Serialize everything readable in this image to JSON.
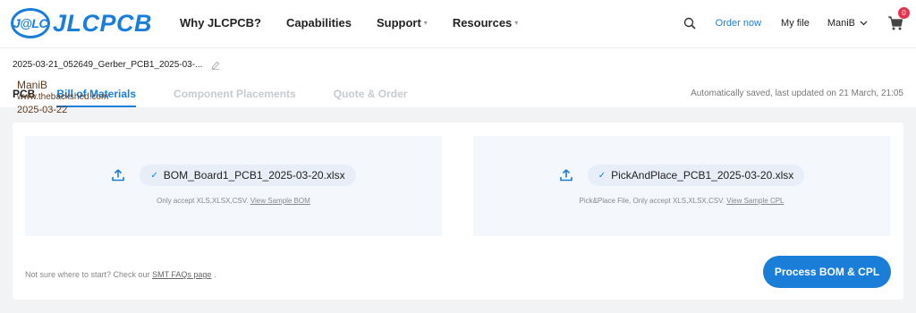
{
  "header": {
    "logo_mark": "J@LC",
    "logo_text": "JLCPCB",
    "nav": [
      {
        "label": "Why JLCPCB?",
        "dropdown": false
      },
      {
        "label": "Capabilities",
        "dropdown": false
      },
      {
        "label": "Support",
        "dropdown": true
      },
      {
        "label": "Resources",
        "dropdown": true
      }
    ],
    "order_now": "Order now",
    "my_file": "My file",
    "user": "ManiB",
    "cart_count": "0"
  },
  "file": {
    "name": "2025-03-21_052649_Gerber_PCB1_2025-03-..."
  },
  "tabs": [
    {
      "label": "PCB",
      "state": "done"
    },
    {
      "label": "Bill of Materials",
      "state": "active"
    },
    {
      "label": "Component Placements",
      "state": "pending"
    },
    {
      "label": "Quote & Order",
      "state": "pending"
    }
  ],
  "autosave": "Automatically saved, last updated on 21 March, 21:05",
  "watermark": {
    "name": "ManiB",
    "url": "www.thebackshed.com",
    "date": "2025-03-22"
  },
  "bom_upload": {
    "file": "BOM_Board1_PCB1_2025-03-20.xlsx",
    "hint": "Only accept XLS,XLSX,CSV.",
    "link": "View Sample BOM"
  },
  "cpl_upload": {
    "file": "PickAndPlace_PCB1_2025-03-20.xlsx",
    "hint": "Pick&Place File, Only accept XLS,XLSX,CSV.",
    "link": "View Sample CPL"
  },
  "footer": {
    "note": "Not sure where to start? Check our",
    "link": "SMT FAQs page",
    "suffix": "."
  },
  "process_button": "Process BOM & CPL",
  "colors": {
    "accent": "#1a7ed8",
    "badge": "#e6344f",
    "upload_bg": "#f4f8fd"
  }
}
